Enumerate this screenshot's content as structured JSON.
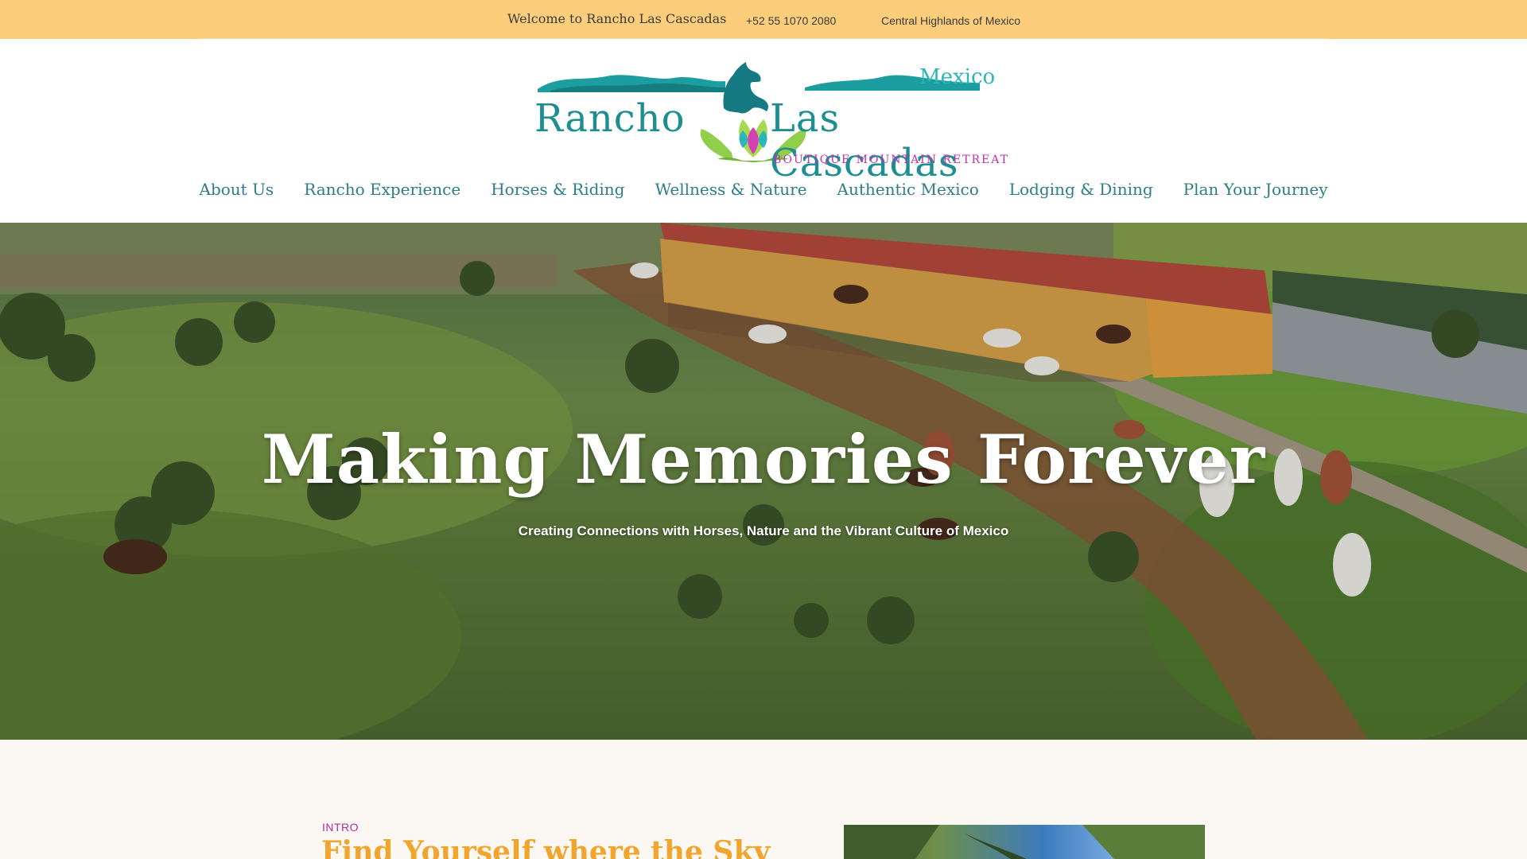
{
  "topbar": {
    "welcome": "Welcome to Rancho Las Cascadas",
    "phone": "+52 55 1070 2080",
    "region": "Central Highlands of Mexico",
    "background_color": "#fcce7c"
  },
  "logo": {
    "word1": "Rancho",
    "word2": "Las Cascadas",
    "country": "Mexico",
    "tagline": "Boutique Mountain Retreat",
    "primary_color": "#1d8e91",
    "accent_color": "#c12fb3",
    "icon": "horse-lotus-logo-icon"
  },
  "nav": {
    "items": [
      {
        "label": "About Us"
      },
      {
        "label": "Rancho Experience"
      },
      {
        "label": "Horses & Riding"
      },
      {
        "label": "Wellness & Nature"
      },
      {
        "label": "Authentic Mexico"
      },
      {
        "label": "Lodging & Dining"
      },
      {
        "label": "Plan Your Journey"
      }
    ],
    "color": "#2f7d86"
  },
  "hero": {
    "title": "Making Memories Forever",
    "subtitle": "Creating Connections with Horses, Nature and the Vibrant Culture of Mexico"
  },
  "intro": {
    "label": "INTRO",
    "title": "Find Yourself where the Sky",
    "title_color": "#f2a52d",
    "label_color": "#b22fa5"
  }
}
